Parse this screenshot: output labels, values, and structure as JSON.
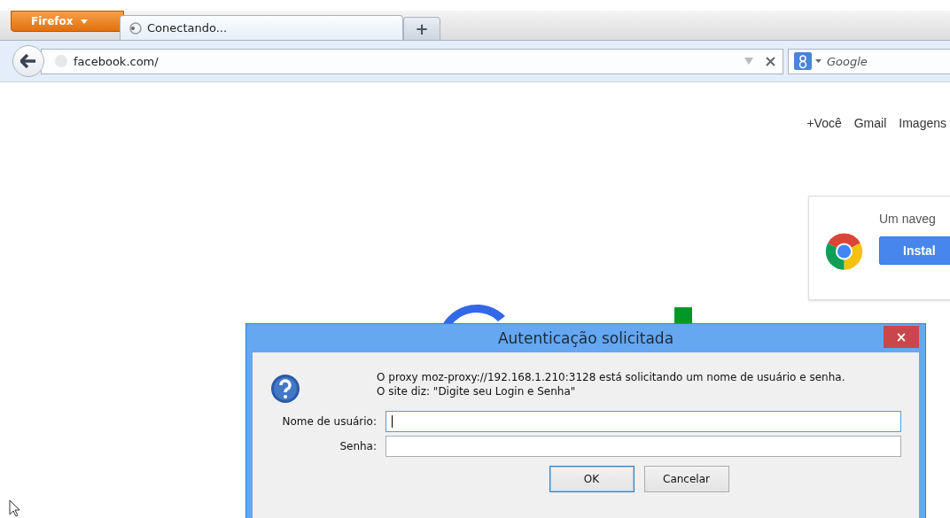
{
  "browser": {
    "menu_button": "Firefox",
    "tabs": [
      {
        "label": "Conectando...",
        "selected": true
      }
    ],
    "new_tab": "+",
    "address": "facebook.com/",
    "search": {
      "placeholder": "Google"
    }
  },
  "page": {
    "top_links": [
      "+Você",
      "Gmail",
      "Imagens"
    ],
    "promo": {
      "text": "Um naveg",
      "button": "Instal"
    }
  },
  "dialog": {
    "title": "Autenticação solicitada",
    "close": "×",
    "message": [
      "O proxy moz-proxy://192.168.1.210:3128 está solicitando um nome de usuário e senha.",
      "O site diz: \"Digite seu Login e Senha\""
    ],
    "fields": [
      {
        "label": "Nome de usuário:",
        "focused": true
      },
      {
        "label": "Senha:",
        "focused": false
      }
    ],
    "buttons": [
      {
        "label": "OK",
        "default": true
      },
      {
        "label": "Cancelar",
        "default": false
      }
    ]
  }
}
